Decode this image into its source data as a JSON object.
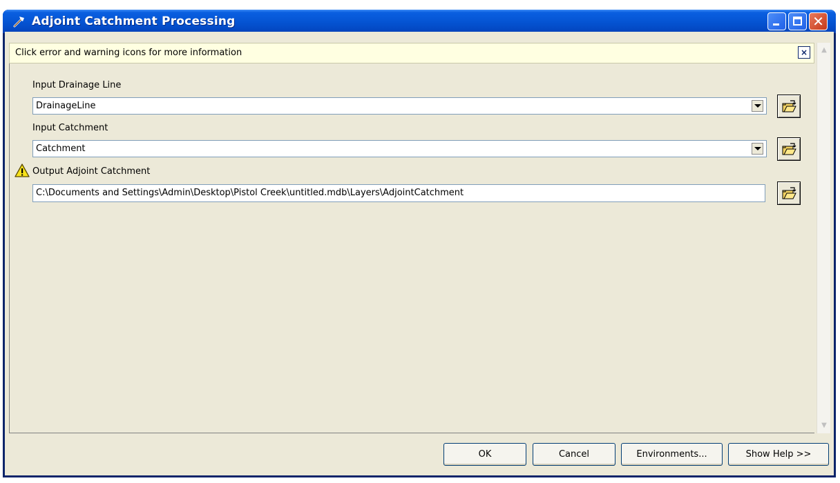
{
  "window": {
    "title": "Adjoint Catchment Processing",
    "controls": {
      "minimize": "minimize-icon",
      "maximize": "maximize-icon",
      "close": "close-icon"
    },
    "colors": {
      "titlebar": "#0555d4",
      "frame": "#0a246a",
      "body": "#ece9d8",
      "message_bar": "#ffffe1"
    }
  },
  "message_bar": {
    "text": "Click error and warning icons for more information",
    "close_icon": "×"
  },
  "fields": [
    {
      "label": "Input Drainage Line",
      "value": "DrainageLine",
      "type": "combo"
    },
    {
      "label": "Input Catchment",
      "value": "Catchment",
      "type": "combo"
    },
    {
      "label": "Output Adjoint Catchment",
      "value": "C:\\Documents and Settings\\Admin\\Desktop\\Pistol Creek\\untitled.mdb\\Layers\\AdjointCatchment",
      "type": "text",
      "status": "warning"
    }
  ],
  "buttons": {
    "ok": "OK",
    "cancel": "Cancel",
    "environments": "Environments...",
    "show_help": "Show Help >>"
  }
}
